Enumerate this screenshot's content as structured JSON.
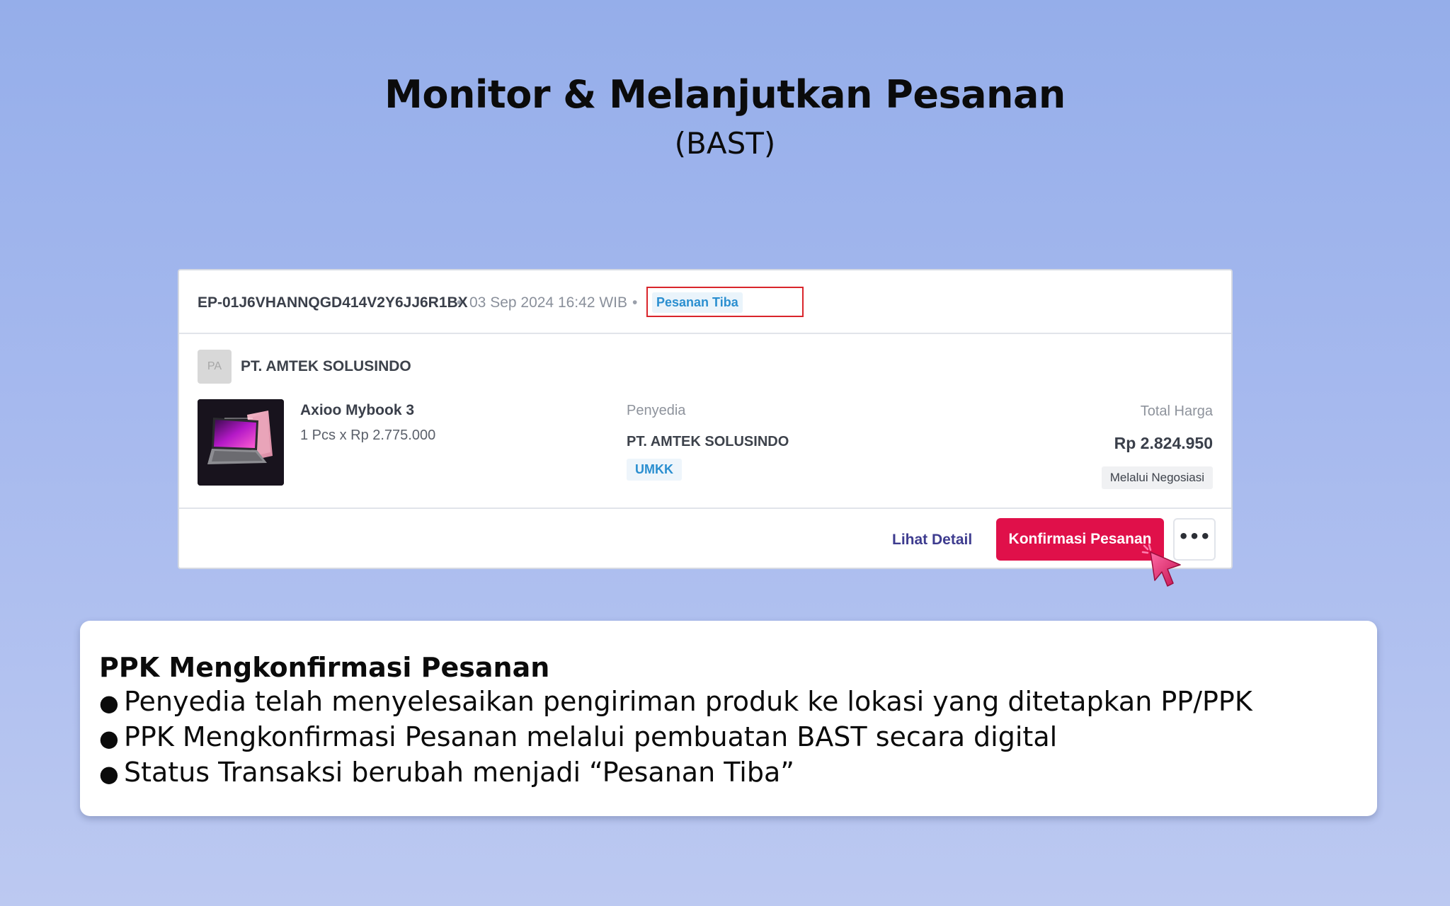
{
  "slide": {
    "title": "Monitor & Melanjutkan Pesanan",
    "subtitle": "(BAST)"
  },
  "order": {
    "id": "EP-01J6VHANNQGD414V2Y6JJ6R1BX",
    "separator": "•",
    "date": "03 Sep 2024 16:42 WIB",
    "status": "Pesanan Tiba",
    "seller_avatar": "PA",
    "seller_name": "PT. AMTEK SOLUSINDO",
    "product": {
      "name": "Axioo Mybook 3",
      "quantity_price": "1 Pcs x Rp 2.775.000",
      "image_icon": "laptop-icon"
    },
    "vendor": {
      "label": "Penyedia",
      "name": "PT. AMTEK SOLUSINDO",
      "tag": "UMKK"
    },
    "total": {
      "label": "Total Harga",
      "value": "Rp 2.824.950",
      "method": "Melalui Negosiasi"
    },
    "actions": {
      "detail_label": "Lihat Detail",
      "confirm_label": "Konfirmasi Pesanan",
      "more_label": "•••"
    },
    "colors": {
      "confirm": "#e0104a",
      "status": "#2b8fd0",
      "highlight": "#d9252b",
      "link": "#3e3c8f"
    }
  },
  "info": {
    "heading": "PPK Mengkonfirmasi Pesanan",
    "bullet": "●",
    "items": [
      "Penyedia telah menyelesaikan pengiriman produk ke lokasi yang ditetapkan PP/PPK",
      "PPK Mengkonfirmasi Pesanan melalui pembuatan BAST secara digital",
      "Status Transaksi berubah menjadi “Pesanan Tiba”"
    ]
  }
}
